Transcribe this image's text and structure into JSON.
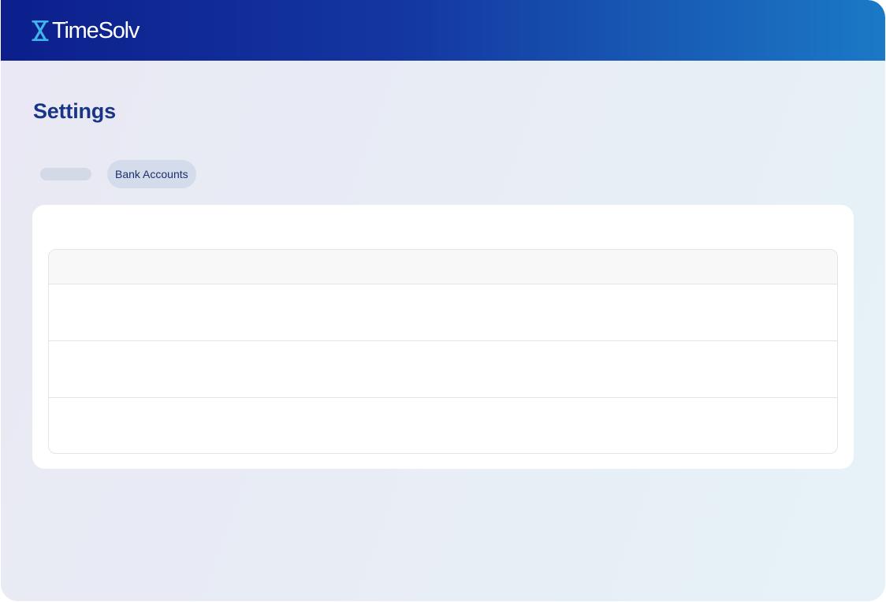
{
  "app": {
    "logo_text": "TimeSolv",
    "logo_icon": "hourglass-icon"
  },
  "page": {
    "title": "Settings"
  },
  "tabs": [
    {
      "label": "",
      "state": "loading"
    },
    {
      "label": "Bank Accounts",
      "state": "active"
    }
  ],
  "table": {
    "rows": 3
  },
  "colors": {
    "header_start": "#0c1f8c",
    "header_end": "#1b79c6",
    "title": "#1a3585",
    "active_tab_bg": "#d4dcec"
  }
}
